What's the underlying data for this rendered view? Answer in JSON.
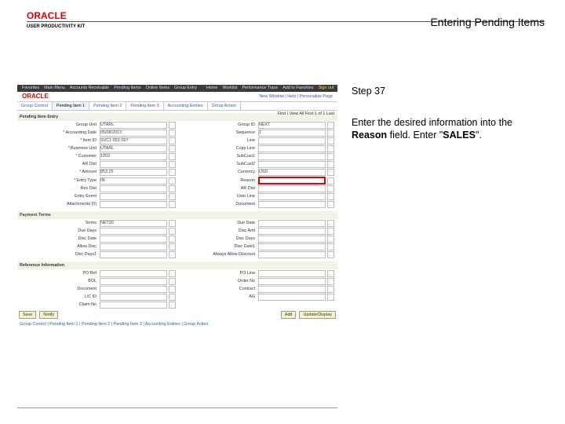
{
  "header": {
    "brand": "ORACLE",
    "subbrand": "USER PRODUCTIVITY KIT",
    "doc_title": "Entering Pending Items"
  },
  "panel": {
    "step_label": "Step 37",
    "instr_pre": "Enter the desired information into the ",
    "instr_field": "Reason",
    "instr_mid": " field. Enter \"",
    "instr_val": "SALES",
    "instr_post": "\"."
  },
  "app": {
    "top_nav": [
      "Favorites",
      "Main Menu",
      "Accounts Receivable",
      "Pending Items",
      "Online Items",
      "Group Entry"
    ],
    "top_right": [
      "Home",
      "Worklist",
      "Performance Trace",
      "Add to Favorites"
    ],
    "top_signout": "Sign out",
    "brand": "ORACLE",
    "user_links": "New Window | Help | Personalize Page",
    "tabs": [
      "Group Control",
      "Pending Item 1",
      "Pending Item 2",
      "Pending Item 3",
      "Accounting Entries",
      "Group Action"
    ],
    "active_tab": 1,
    "find_bar": "Find | View All   First 1 of 1 Last",
    "section1": "Pending Item Entry",
    "fields1": [
      {
        "l": "Group Unit",
        "v": "UTARL",
        "req": false
      },
      {
        "l": "Group ID",
        "v": "NEXT",
        "req": false
      },
      {
        "l": "Accounting Date",
        "v": "05/08/2013",
        "req": true
      },
      {
        "l": "Sequence",
        "v": "1",
        "req": false
      },
      {
        "l": "Item ID",
        "v": "SVC1-051-007",
        "req": true
      },
      {
        "l": "Line",
        "v": "",
        "req": false
      },
      {
        "l": "Business Unit",
        "v": "UTARL",
        "req": true
      },
      {
        "l": "Copy Line",
        "v": "",
        "req": false
      },
      {
        "l": "Customer",
        "v": "1003",
        "req": true
      },
      {
        "l": "SubCust1",
        "v": "",
        "req": false
      },
      {
        "l": "AR Dist",
        "v": "",
        "req": false
      },
      {
        "l": "SubCust2",
        "v": "",
        "req": false
      },
      {
        "l": "Amount",
        "v": "853.25",
        "req": true
      },
      {
        "l": "Currency",
        "v": "USD",
        "req": false
      },
      {
        "l": "Entry Type",
        "v": "IN",
        "req": true
      },
      {
        "l": "Reason",
        "v": "",
        "req": false,
        "hi": true
      },
      {
        "l": "Rev Dist",
        "v": "",
        "req": false
      },
      {
        "l": "AR Dist",
        "v": "",
        "req": false
      },
      {
        "l": "Entry Event",
        "v": "",
        "req": false
      },
      {
        "l": "User Line",
        "v": "",
        "req": false
      },
      {
        "l": "Attachments (0)",
        "v": "",
        "req": false
      },
      {
        "l": "Document",
        "v": "",
        "req": false
      }
    ],
    "section2": "Payment Terms",
    "fields2": [
      {
        "l": "Terms",
        "v": "NET30"
      },
      {
        "l": "Due Date",
        "v": ""
      },
      {
        "l": "Due Days",
        "v": ""
      },
      {
        "l": "Disc Amt",
        "v": ""
      },
      {
        "l": "Disc Date",
        "v": ""
      },
      {
        "l": "Disc Days",
        "v": ""
      },
      {
        "l": "Allow Disc",
        "v": ""
      },
      {
        "l": "Disc Date1",
        "v": ""
      },
      {
        "l": "Disc Days1",
        "v": ""
      },
      {
        "l": "Always Allow Discount",
        "v": ""
      }
    ],
    "section3": "Reference Information",
    "fields3": [
      {
        "l": "PO Ref",
        "v": ""
      },
      {
        "l": "PO Line",
        "v": ""
      },
      {
        "l": "BOL",
        "v": ""
      },
      {
        "l": "Order No",
        "v": ""
      },
      {
        "l": "Document",
        "v": ""
      },
      {
        "l": "Contract",
        "v": ""
      },
      {
        "l": "L/C ID",
        "v": ""
      },
      {
        "l": "AG",
        "v": ""
      },
      {
        "l": "Claim No",
        "v": ""
      }
    ],
    "btn_save": "Save",
    "btn_notify": "Notify",
    "btn_add": "Add",
    "btn_update": "Update/Display",
    "crumb": "Group Control | Pending Item 1 | Pending Item 2 | Pending Item 3 | Accounting Entries | Group Action"
  }
}
